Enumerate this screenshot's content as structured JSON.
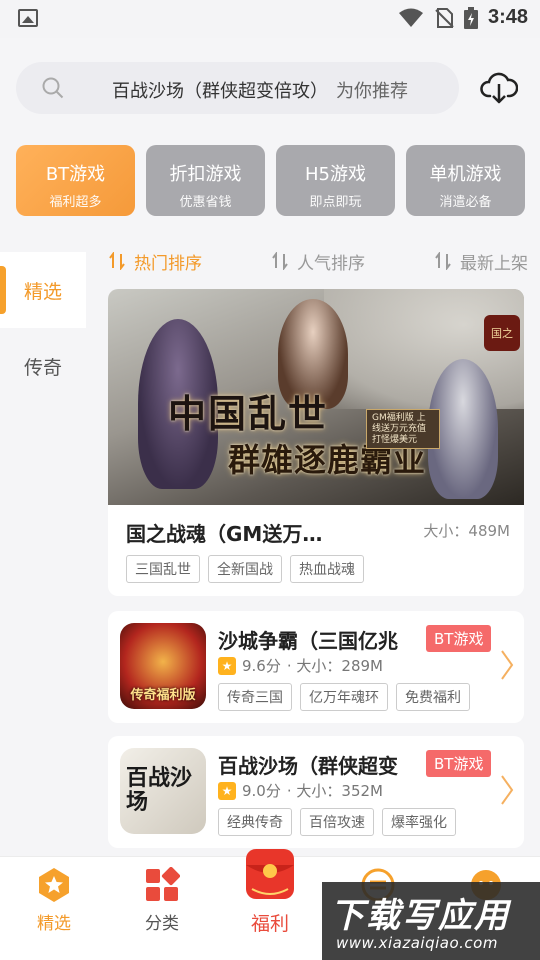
{
  "status": {
    "time": "3:48"
  },
  "search": {
    "query": "百战沙场（群侠超变倍攻）",
    "hint": "为你推荐"
  },
  "categories": [
    {
      "title": "BT游戏",
      "sub": "福利超多"
    },
    {
      "title": "折扣游戏",
      "sub": "优惠省钱"
    },
    {
      "title": "H5游戏",
      "sub": "即点即玩"
    },
    {
      "title": "单机游戏",
      "sub": "消遣必备"
    }
  ],
  "sidebar": {
    "items": [
      {
        "label": "精选"
      },
      {
        "label": "传奇"
      }
    ]
  },
  "sorts": [
    {
      "label": "热门排序"
    },
    {
      "label": "人气排序"
    },
    {
      "label": "最新上架"
    }
  ],
  "featured": {
    "banner_headline": "中国乱世",
    "banner_subline": "群雄逐鹿霸业",
    "banner_seal": "GM福利版 上线送万元充值 打怪爆美元",
    "banner_badge": "国之",
    "title": "国之战魂（GM送万…",
    "size": "大小：489M",
    "tags": [
      "三国乱世",
      "全新国战",
      "热血战魂"
    ]
  },
  "games": [
    {
      "name": "沙城争霸（三国亿兆",
      "badge": "BT游戏",
      "rating": "9.6分",
      "size": "· 大小：289M",
      "tags": [
        "传奇三国",
        "亿万年魂环",
        "免费福利"
      ],
      "icon_text": "传奇福利版"
    },
    {
      "name": "百战沙场（群侠超变",
      "badge": "BT游戏",
      "rating": "9.0分",
      "size": "· 大小：352M",
      "tags": [
        "经典传奇",
        "百倍攻速",
        "爆率强化"
      ],
      "icon_text": "百战沙场"
    }
  ],
  "bottom_nav": [
    {
      "label": "精选"
    },
    {
      "label": "分类"
    },
    {
      "label": "福利"
    }
  ],
  "watermark": {
    "big": "下载写应用",
    "small": "www.xiazaiqiao.com"
  },
  "colors": {
    "accent": "#f39a2a",
    "bt_badge": "#f56a6a",
    "inactive_cat": "#a9a9ad"
  }
}
